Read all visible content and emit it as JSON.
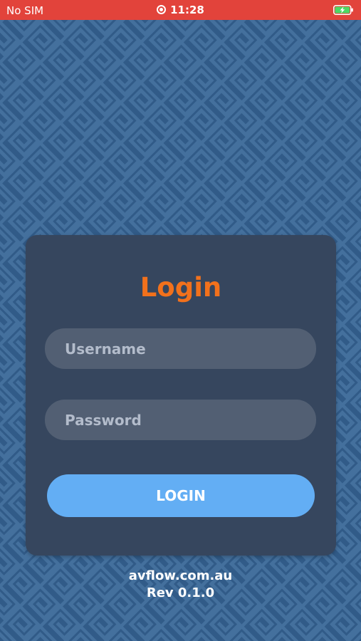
{
  "status_bar": {
    "carrier": "No SIM",
    "time": "11:28",
    "recording_icon": "screen-recording-icon",
    "battery_icon": "battery-charging-icon",
    "background_color": "#e2433b"
  },
  "background": {
    "pattern": "greek-key",
    "color": "#315b88"
  },
  "login": {
    "title": "Login",
    "title_color": "#f2711c",
    "username_placeholder": "Username",
    "password_placeholder": "Password",
    "button_label": "LOGIN",
    "button_color": "#63aef4"
  },
  "footer": {
    "website": "avflow.com.au",
    "revision": "Rev 0.1.0"
  }
}
